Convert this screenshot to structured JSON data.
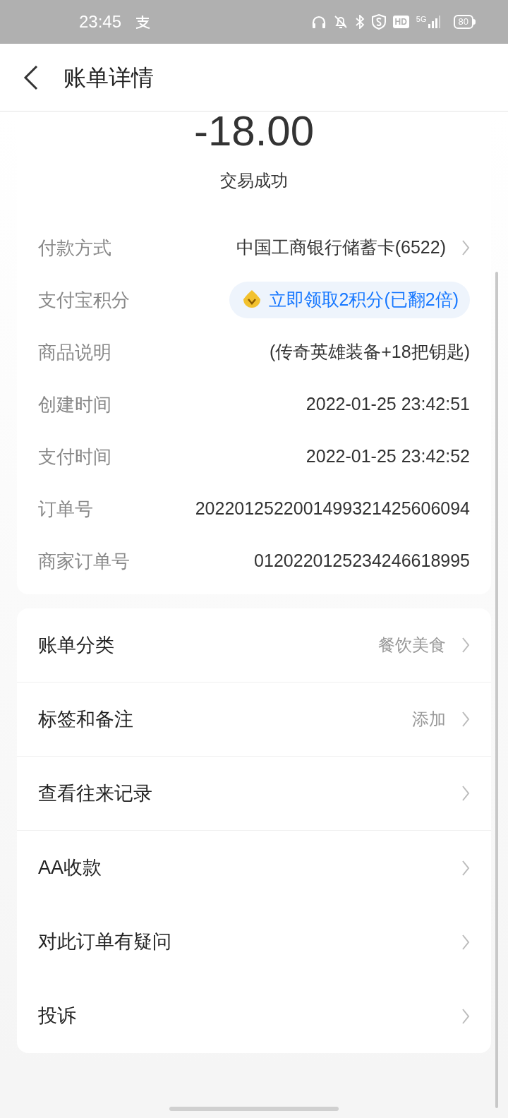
{
  "status_bar": {
    "time": "23:45",
    "hd": "HD",
    "network": "5G",
    "battery": "80"
  },
  "header": {
    "title": "账单详情"
  },
  "summary": {
    "amount": "-18.00",
    "status": "交易成功"
  },
  "details": [
    {
      "kind": "link",
      "label": "付款方式",
      "value": "中国工商银行储蓄卡(6522)"
    },
    {
      "kind": "points",
      "label": "支付宝积分",
      "value": "立即领取2积分(已翻2倍)"
    },
    {
      "kind": "text",
      "label": "商品说明",
      "value": "(传奇英雄装备+18把钥匙)"
    },
    {
      "kind": "text",
      "label": "创建时间",
      "value": "2022-01-25 23:42:51"
    },
    {
      "kind": "text",
      "label": "支付时间",
      "value": "2022-01-25 23:42:52"
    },
    {
      "kind": "text",
      "label": "订单号",
      "value": "2022012522001499321425606094"
    },
    {
      "kind": "text",
      "label": "商家订单号",
      "value": "0120220125234246618995"
    }
  ],
  "menu": [
    {
      "label": "账单分类",
      "value": "餐饮美食"
    },
    {
      "label": "标签和备注",
      "value": "添加"
    },
    {
      "label": "查看往来记录"
    },
    {
      "label": "AA收款"
    },
    {
      "label": "对此订单有疑问"
    },
    {
      "label": "投诉"
    }
  ]
}
